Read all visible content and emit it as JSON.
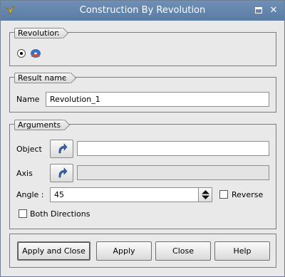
{
  "window": {
    "title": "Construction By Revolution"
  },
  "revolution": {
    "group_label": "Revolution"
  },
  "result": {
    "group_label": "Result name",
    "name_label": "Name",
    "name_value": "Revolution_1"
  },
  "arguments": {
    "group_label": "Arguments",
    "object_label": "Object",
    "axis_label": "Axis",
    "angle_label": "Angle :",
    "angle_value": "45",
    "reverse_label": "Reverse",
    "both_directions_label": "Both Directions"
  },
  "buttons": {
    "apply_close": "Apply and Close",
    "apply": "Apply",
    "close": "Close",
    "help": "Help"
  },
  "colors": {
    "titlebar": "#6083ac",
    "dialog_bg": "#e9e9e9"
  },
  "icons": {
    "app": "salome-app-icon",
    "revolution": "revolution-shape-icon",
    "select": "select-arrow-icon"
  }
}
